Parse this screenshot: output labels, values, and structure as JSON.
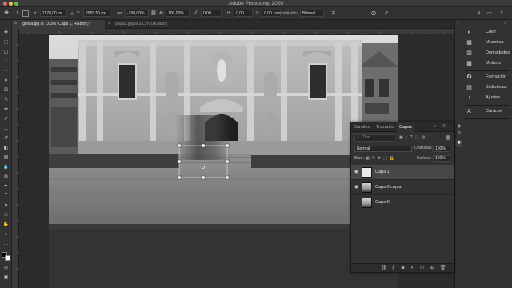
{
  "window": {
    "title": "Adobe Photoshop 2020",
    "traffic_lights": [
      "#ed6a5e",
      "#f4bf4f",
      "#61c554"
    ]
  },
  "options_bar": {
    "x_label": "X:",
    "x_value": "1178,00 px",
    "y_label": "Y:",
    "y_value": "2965,50 px",
    "w_label": "An:",
    "w_value": "-100,00%",
    "h_label": "Al:",
    "h_value": "100,00%",
    "angle_value": "0,00",
    "skew_h_label": "H:",
    "skew_h_value": "0,00",
    "skew_v_label": "V:",
    "skew_v_value": "0,00",
    "interp_label": "Interpolación:",
    "interp_value": "Bilineal",
    "cancel_icon": "cancel-circle-icon",
    "commit_icon": "checkmark-icon"
  },
  "tabs": [
    {
      "label": "iglesia.jpg al 73,3% (Capa 1, RGB/8*) *",
      "active": true
    },
    {
      "label": "playa2.jpg al 33,3% (RGB/8*)",
      "active": false
    }
  ],
  "right_panel": {
    "items": [
      {
        "label": "Color",
        "icon": "color-wheel-icon"
      },
      {
        "label": "Muestras",
        "icon": "swatches-icon"
      },
      {
        "label": "Degradados",
        "icon": "gradient-icon"
      },
      {
        "label": "Motivos",
        "icon": "patterns-icon"
      },
      {
        "label": "Formación",
        "icon": "learn-icon"
      },
      {
        "label": "Bibliotecas",
        "icon": "libraries-icon"
      },
      {
        "label": "Ajustes",
        "icon": "adjustments-icon"
      },
      {
        "label": "Carácter",
        "icon": "character-icon"
      }
    ]
  },
  "layers_panel": {
    "tabs": [
      "Canales",
      "Trazados",
      "Capas"
    ],
    "active_tab": "Capas",
    "search_placeholder": "Tipo",
    "blend_mode": "Normal",
    "opacity_label": "Opacidad:",
    "opacity_value": "100%",
    "lock_label": "Bloq.:",
    "fill_label": "Relleno:",
    "fill_value": "100%",
    "layers": [
      {
        "name": "Capa 1",
        "selected": true,
        "visible": true
      },
      {
        "name": "Capa 0 copia",
        "selected": false,
        "visible": true
      },
      {
        "name": "Capa 0",
        "selected": false,
        "visible": false
      }
    ]
  }
}
